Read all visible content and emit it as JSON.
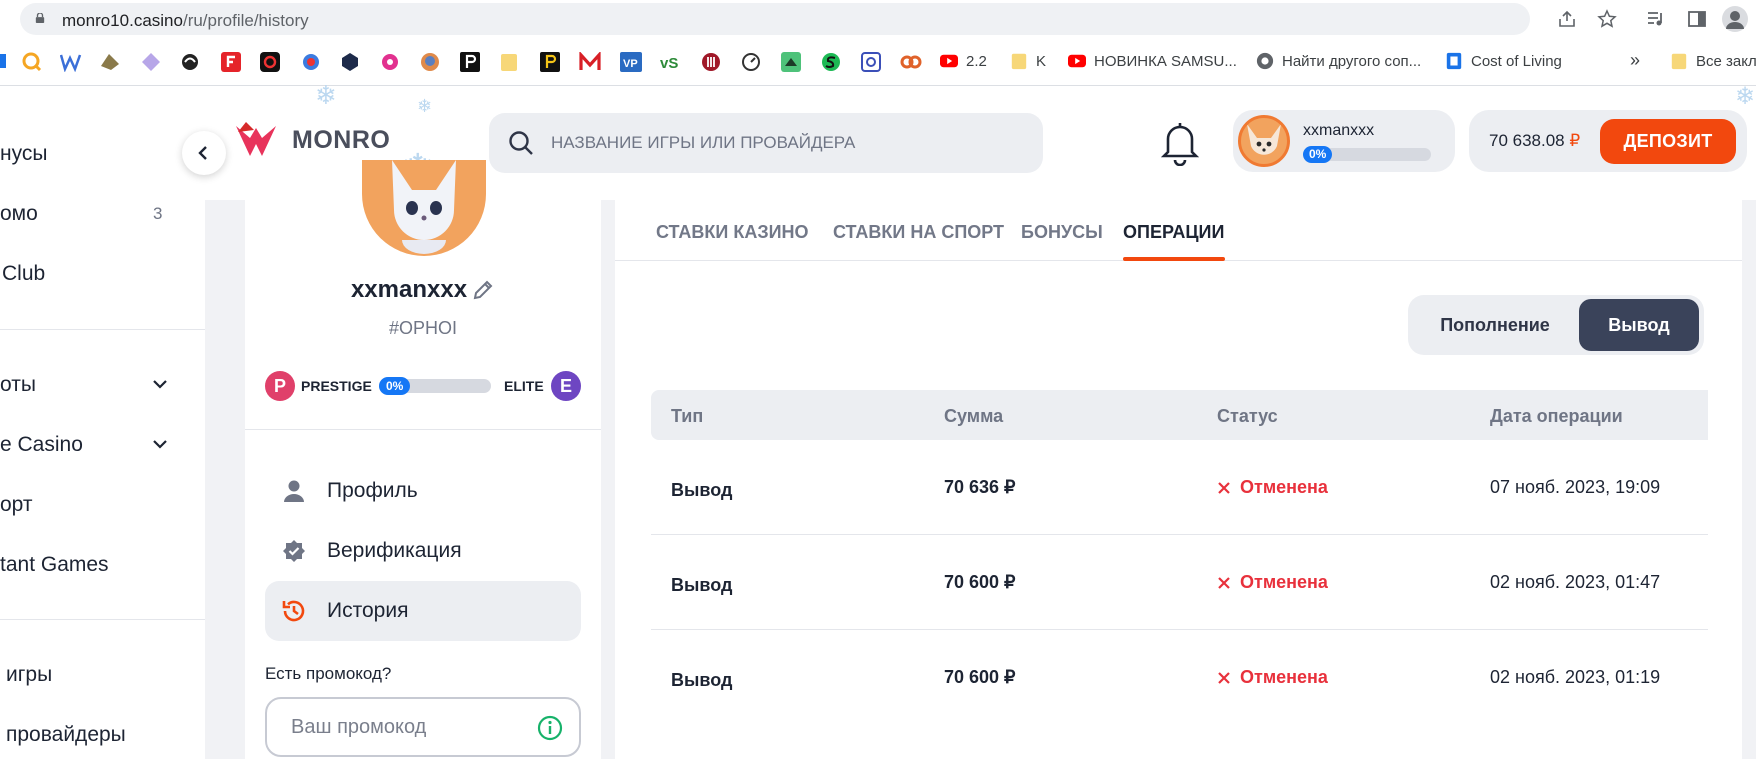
{
  "browser": {
    "url_host": "monro10.casino",
    "url_path": "/ru/profile/history",
    "bookmarks": [
      {
        "label": "2.2",
        "icon": "youtube-icon",
        "color": "#ff0000"
      },
      {
        "label": "K",
        "icon": "folder-icon",
        "color": "#f7d778"
      },
      {
        "label": "НОВИНКА SAMSU...",
        "icon": "youtube-icon",
        "color": "#ff0000"
      },
      {
        "label": "Найти другого соп...",
        "icon": "globe-icon",
        "color": "#5f6368"
      },
      {
        "label": "Cost of Living",
        "icon": "site-icon",
        "color": "#1a73e8"
      },
      {
        "label": "»",
        "icon": "overflow-icon",
        "color": "#5f6368"
      },
      {
        "label": "Все закл",
        "icon": "folder-icon",
        "color": "#f7d778"
      }
    ]
  },
  "header": {
    "logo_text": "MONRO",
    "search_placeholder": "НАЗВАНИЕ ИГРЫ ИЛИ ПРОВАЙДЕРА",
    "username": "xxmanxxx",
    "level_progress": "0%",
    "balance_amount": "70 638.08",
    "balance_currency": "₽",
    "deposit_label": "ДЕПОЗИТ"
  },
  "sidebar": {
    "items": [
      {
        "label": "нусы"
      },
      {
        "label": "омо",
        "count": "3"
      },
      {
        "label": "Club"
      },
      {
        "label": "оты"
      },
      {
        "label": "e Casino"
      },
      {
        "label": "орт"
      },
      {
        "label": "tant Games"
      },
      {
        "label": "игры"
      },
      {
        "label": "провайдеры"
      }
    ]
  },
  "profile": {
    "name": "xxmanxxx",
    "id": "#OPHOI",
    "level_current_badge": "P",
    "level_current": "PRESTIGE",
    "level_progress": "0%",
    "level_next": "ELITE",
    "level_next_badge": "E",
    "menu": [
      {
        "label": "Профиль",
        "icon": "person-icon"
      },
      {
        "label": "Верификация",
        "icon": "verified-icon"
      },
      {
        "label": "История",
        "icon": "history-icon"
      }
    ],
    "promo_question": "Есть промокод?",
    "promo_placeholder": "Ваш промокод"
  },
  "history": {
    "tabs": [
      "СТАВКИ КАЗИНО",
      "СТАВКИ НА СПОРТ",
      "БОНУСЫ",
      "ОПЕРАЦИИ"
    ],
    "active_tab": "ОПЕРАЦИИ",
    "segments": [
      "Пополнение",
      "Вывод"
    ],
    "active_segment": "Вывод",
    "columns": [
      "Тип",
      "Сумма",
      "Статус",
      "Дата операции"
    ],
    "rows": [
      {
        "type": "Вывод",
        "amount": "70 636 ₽",
        "status": "Отменена",
        "date": "07 нояб. 2023, 19:09"
      },
      {
        "type": "Вывод",
        "amount": "70 600 ₽",
        "status": "Отменена",
        "date": "02 нояб. 2023, 01:47"
      },
      {
        "type": "Вывод",
        "amount": "70 600 ₽",
        "status": "Отменена",
        "date": "02 нояб. 2023, 01:19"
      }
    ]
  },
  "colors": {
    "accent": "#f2480e",
    "progress": "#1577f5",
    "cancelled": "#e8313c",
    "segment_active": "#3a435a"
  }
}
